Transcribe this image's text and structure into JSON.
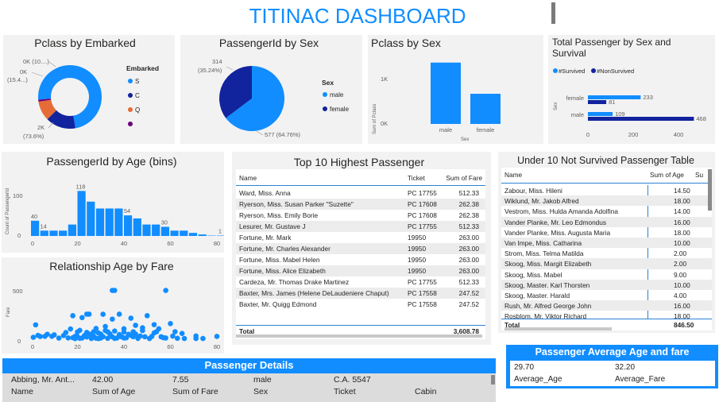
{
  "dashboard": {
    "title": "TITINAC DASHBOARD"
  },
  "colors": {
    "blue": "#118DFF",
    "navy": "#12239E",
    "orange": "#E66C37",
    "purple": "#6B007B",
    "banner": "#118DFF"
  },
  "pclass_embarked": {
    "title": "Pclass by Embarked",
    "legend_title": "Embarked",
    "legend": [
      "S",
      "C",
      "Q",
      ""
    ],
    "labels": {
      "a": "0K (10....)",
      "b": "0K",
      "c": "(15.4...)",
      "d": "2K",
      "e": "(73.6%)"
    },
    "chart_data": {
      "type": "pie",
      "categories": [
        "S",
        "C",
        "Q",
        ""
      ],
      "values": [
        73.6,
        15.4,
        10.0,
        1.0
      ]
    }
  },
  "pid_sex": {
    "title": "PassengerId by Sex",
    "legend_title": "Sex",
    "legend": [
      "male",
      "female"
    ],
    "label_female": "314",
    "label_female_pct": "(35.24%)",
    "label_male": "577 (64.76%)",
    "chart_data": {
      "type": "pie",
      "categories": [
        "male",
        "female"
      ],
      "values": [
        577,
        314
      ]
    }
  },
  "pclass_sex": {
    "title": "Pclass by Sex",
    "ylabel": "Sum of Pclass",
    "xlabel": "Sex",
    "yticks": [
      "1K",
      "0K"
    ],
    "chart_data": {
      "type": "bar",
      "categories": [
        "male",
        "female"
      ],
      "values": [
        1379,
        678
      ],
      "ylim": [
        0,
        1500
      ]
    }
  },
  "survival": {
    "title_line1": "Total Passenger by Sex and",
    "title_line2": "Survival",
    "legend": [
      "#Survived",
      "#NonSurvived"
    ],
    "ylabel": "Sex",
    "xticks": [
      "0",
      "200",
      "400"
    ],
    "chart_data": {
      "type": "bar",
      "categories": [
        "female",
        "male"
      ],
      "series": [
        {
          "name": "#Survived",
          "values": [
            233,
            109
          ]
        },
        {
          "name": "#NonSurvived",
          "values": [
            81,
            468
          ]
        }
      ],
      "xlim": [
        0,
        500
      ]
    }
  },
  "age_bins": {
    "title": "PassengerId by Age (bins)",
    "ylabel": "Count of PassengerId",
    "yticks": [
      "100",
      "0"
    ],
    "xticks": [
      "0",
      "20",
      "40",
      "60",
      "80"
    ],
    "chart_data": {
      "type": "bar",
      "x": [
        0,
        4,
        8,
        12,
        16,
        20,
        24,
        28,
        32,
        36,
        40,
        44,
        48,
        52,
        56,
        60,
        64,
        68,
        72,
        76,
        80
      ],
      "values": [
        40,
        14,
        14,
        14,
        30,
        118,
        90,
        72,
        72,
        72,
        54,
        46,
        30,
        30,
        24,
        14,
        14,
        8,
        4,
        1,
        1
      ],
      "data_labels": {
        "0": "40",
        "1": "14",
        "5": "118",
        "10": "54",
        "14": "30",
        "20": "1"
      },
      "ylim": [
        0,
        130
      ]
    }
  },
  "age_fare": {
    "title": "Relationship Age by Fare",
    "ylabel": "Fare",
    "yticks": [
      "500",
      "0"
    ],
    "xticks": [
      "0",
      "20",
      "40",
      "60",
      "80"
    ],
    "chart_data": {
      "type": "scatter",
      "xlim": [
        0,
        80
      ],
      "ylim": [
        0,
        600
      ],
      "points": [
        [
          35,
          512
        ],
        [
          36,
          512
        ],
        [
          58,
          512
        ],
        [
          25,
          263
        ],
        [
          24,
          263
        ],
        [
          31,
          262
        ],
        [
          38,
          263
        ],
        [
          50,
          247
        ],
        [
          18,
          247
        ],
        [
          22,
          227
        ],
        [
          35,
          211
        ],
        [
          43,
          221
        ],
        [
          53,
          153
        ],
        [
          60,
          164
        ],
        [
          45,
          146
        ],
        [
          32,
          134
        ],
        [
          2,
          151
        ],
        [
          17,
          108
        ],
        [
          28,
          113
        ],
        [
          40,
          110
        ],
        [
          48,
          120
        ],
        [
          55,
          110
        ],
        [
          21,
          93
        ],
        [
          32,
          91
        ],
        [
          36,
          86
        ],
        [
          48,
          91
        ],
        [
          40,
          76
        ],
        [
          27,
          79
        ],
        [
          24,
          71
        ],
        [
          44,
          78
        ],
        [
          54,
          79
        ],
        [
          62,
          79
        ],
        [
          65,
          61
        ],
        [
          7,
          52
        ],
        [
          10,
          46
        ],
        [
          14,
          39
        ],
        [
          19,
          31
        ],
        [
          23,
          39
        ],
        [
          27,
          30
        ],
        [
          30,
          53
        ],
        [
          34,
          56
        ],
        [
          38,
          50
        ],
        [
          42,
          52
        ],
        [
          45,
          55
        ],
        [
          49,
          26
        ],
        [
          52,
          30
        ],
        [
          56,
          26
        ],
        [
          4,
          29
        ],
        [
          9,
          31
        ],
        [
          16,
          14
        ],
        [
          22,
          13
        ],
        [
          26,
          8
        ],
        [
          29,
          7
        ],
        [
          33,
          10
        ],
        [
          37,
          13
        ],
        [
          41,
          15
        ],
        [
          46,
          9
        ],
        [
          51,
          8
        ],
        [
          58,
          13
        ],
        [
          61,
          33
        ],
        [
          63,
          10
        ],
        [
          66,
          8
        ],
        [
          71,
          34
        ],
        [
          71,
          8
        ],
        [
          74,
          8
        ],
        [
          80,
          30
        ],
        [
          1,
          20
        ],
        [
          3,
          40
        ],
        [
          6,
          31
        ],
        [
          12,
          12
        ],
        [
          20,
          26
        ],
        [
          25,
          55
        ],
        [
          31,
          27
        ],
        [
          39,
          26
        ],
        [
          44,
          27
        ],
        [
          47,
          34
        ],
        [
          15,
          70
        ],
        [
          20,
          76
        ],
        [
          29,
          66
        ],
        [
          33,
          78
        ],
        [
          35,
          25
        ],
        [
          43,
          40
        ],
        [
          53,
          66
        ],
        [
          57,
          16
        ],
        [
          19,
          7
        ],
        [
          28,
          11
        ],
        [
          24,
          24
        ],
        [
          21,
          10
        ],
        [
          30,
          12
        ],
        [
          36,
          9
        ],
        [
          40,
          13
        ],
        [
          18,
          16
        ],
        [
          26,
          52
        ]
      ]
    }
  },
  "top10": {
    "title": "Top 10 Highest Passenger",
    "headers": [
      "Name",
      "Ticket",
      "Sum of Fare"
    ],
    "rows": [
      [
        "Ward, Miss. Anna",
        "PC 17755",
        "512.33"
      ],
      [
        "Ryerson, Miss. Susan Parker \"Suzette\"",
        "PC 17608",
        "262.38"
      ],
      [
        "Ryerson, Miss. Emily Borie",
        "PC 17608",
        "262.38"
      ],
      [
        "Lesurer, Mr. Gustave J",
        "PC 17755",
        "512.33"
      ],
      [
        "Fortune, Mr. Mark",
        "19950",
        "263.00"
      ],
      [
        "Fortune, Mr. Charles Alexander",
        "19950",
        "263.00"
      ],
      [
        "Fortune, Miss. Mabel Helen",
        "19950",
        "263.00"
      ],
      [
        "Fortune, Miss. Alice Elizabeth",
        "19950",
        "263.00"
      ],
      [
        "Cardeza, Mr. Thomas Drake Martinez",
        "PC 17755",
        "512.33"
      ],
      [
        "Baxter, Mrs. James (Helene DeLaudeniere Chaput)",
        "PC 17558",
        "247.52"
      ],
      [
        "Baxter, Mr. Quigg Edmond",
        "PC 17558",
        "247.52"
      ]
    ],
    "total_label": "Total",
    "total_value": "3,608.78"
  },
  "under10": {
    "title": "Under 10 Not Survived Passenger Table",
    "headers": [
      "Name",
      "Sum of Age",
      "Su"
    ],
    "rows": [
      [
        "Zabour, Miss. Hileni",
        "14.50"
      ],
      [
        "Wiklund, Mr. Jakob Alfred",
        "18.00"
      ],
      [
        "Vestrom, Miss. Hulda Amanda Adolfina",
        "14.00"
      ],
      [
        "Vander Planke, Mr. Leo Edmondus",
        "16.00"
      ],
      [
        "Vander Planke, Miss. Augusta Maria",
        "18.00"
      ],
      [
        "Van Impe, Miss. Catharina",
        "10.00"
      ],
      [
        "Strom, Miss. Telma Matilda",
        "2.00"
      ],
      [
        "Skoog, Miss. Margit Elizabeth",
        "2.00"
      ],
      [
        "Skoog, Miss. Mabel",
        "9.00"
      ],
      [
        "Skoog, Master. Karl Thorsten",
        "10.00"
      ],
      [
        "Skoog, Master. Harald",
        "4.00"
      ],
      [
        "Rush, Mr. Alfred George John",
        "16.00"
      ],
      [
        "Rosblom, Mr. Viktor Richard",
        "18.00"
      ]
    ],
    "total_label": "Total",
    "total_value": "846.50"
  },
  "details": {
    "title": "Passenger Details",
    "values": [
      "Abbing, Mr. Ant...",
      "42.00",
      "7.55",
      "male",
      "C.A. 5547",
      ""
    ],
    "headers": [
      "Name",
      "Sum of Age",
      "Sum of Fare",
      "Sex",
      "Ticket",
      "Cabin"
    ]
  },
  "avg": {
    "title": "Passenger Average Age and fare",
    "age_value": "29.70",
    "age_label": "Average_Age",
    "fare_value": "32.20",
    "fare_label": "Average_Fare"
  }
}
